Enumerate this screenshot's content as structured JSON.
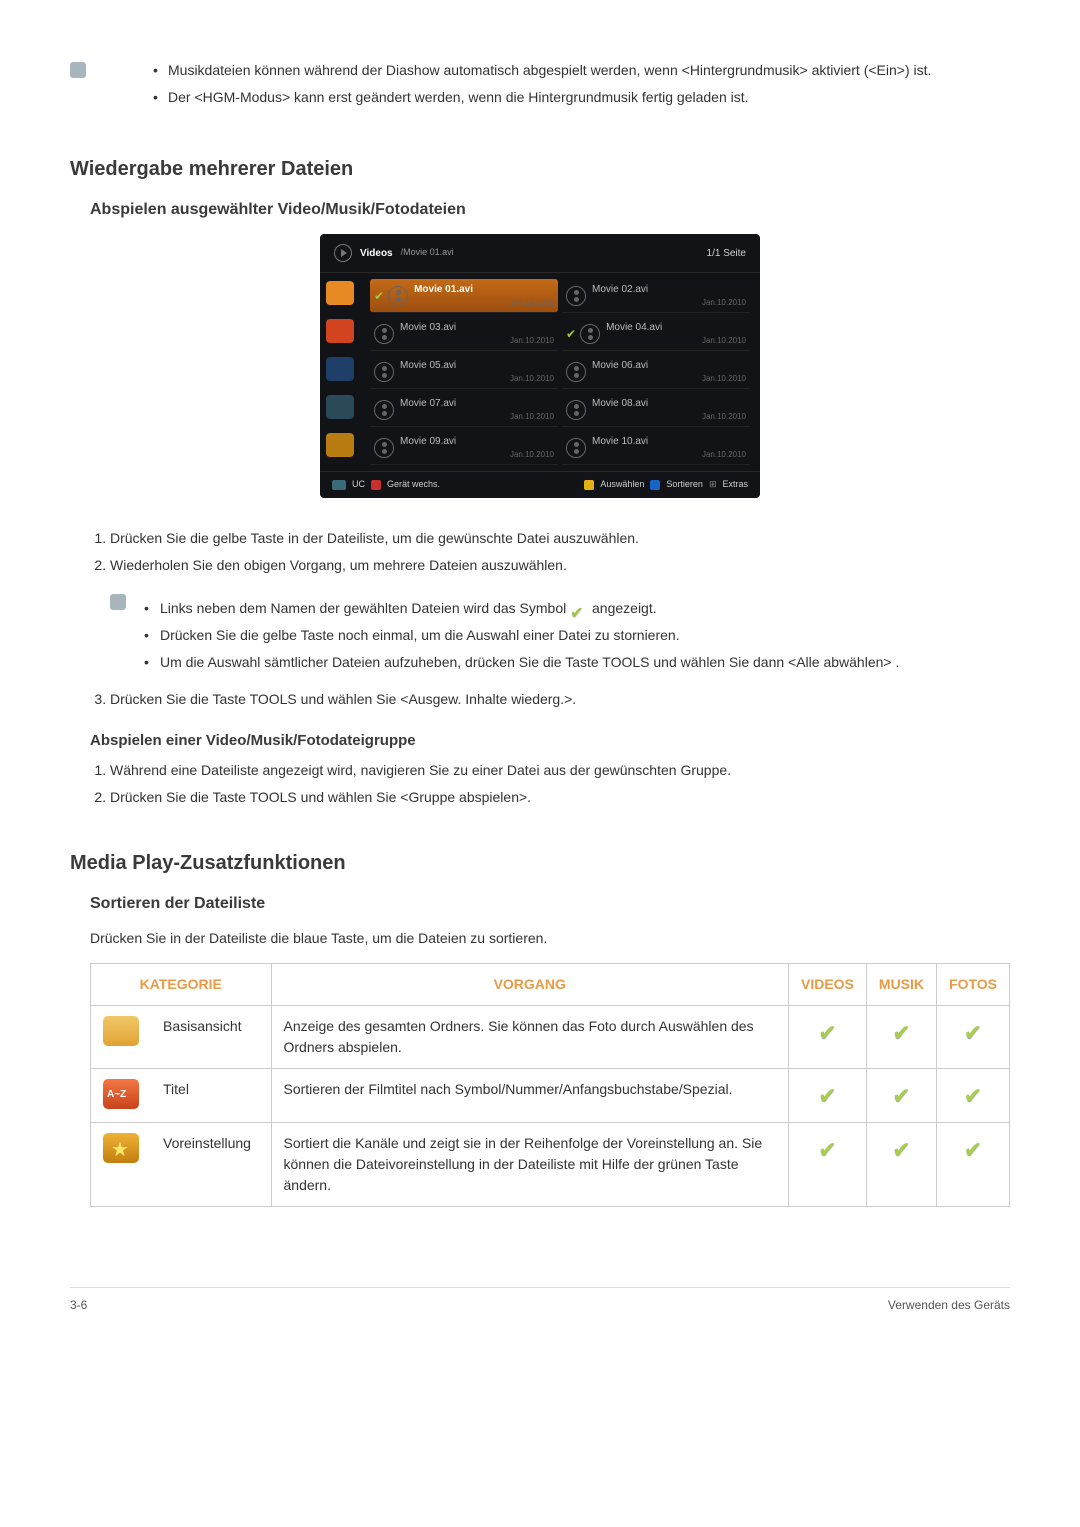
{
  "top_notes": [
    "Musikdateien können während der Diashow automatisch abgespielt werden, wenn <Hintergrundmusik> aktiviert (<Ein>) ist.",
    "Der <HGM-Modus> kann erst geändert werden, wenn die Hintergrundmusik fertig geladen ist."
  ],
  "section1": {
    "title": "Wiedergabe mehrerer Dateien",
    "subtitle": "Abspielen ausgewählter Video/Musik/Fotodateien"
  },
  "screenshot": {
    "category": "Videos",
    "breadcrumb": "/Movie 01.avi",
    "page": "1/1 Seite",
    "files": [
      {
        "name": "Movie 01.avi",
        "date": "Jan.10.2010",
        "checked": true,
        "active": true
      },
      {
        "name": "Movie 02.avi",
        "date": "Jan.10.2010",
        "checked": false,
        "active": false
      },
      {
        "name": "Movie 03.avi",
        "date": "Jan.10.2010",
        "checked": false,
        "active": false
      },
      {
        "name": "Movie 04.avi",
        "date": "Jan.10.2010",
        "checked": true,
        "active": false
      },
      {
        "name": "Movie 05.avi",
        "date": "Jan.10.2010",
        "checked": false,
        "active": false
      },
      {
        "name": "Movie 06.avi",
        "date": "Jan.10.2010",
        "checked": false,
        "active": false
      },
      {
        "name": "Movie 07.avi",
        "date": "Jan.10.2010",
        "checked": false,
        "active": false
      },
      {
        "name": "Movie 08.avi",
        "date": "Jan.10.2010",
        "checked": false,
        "active": false
      },
      {
        "name": "Movie 09.avi",
        "date": "Jan.10.2010",
        "checked": false,
        "active": false
      },
      {
        "name": "Movie 10.avi",
        "date": "Jan.10.2010",
        "checked": false,
        "active": false
      }
    ],
    "footer": {
      "device_btn": "UC",
      "device_label": "Gerät wechs.",
      "select": "Auswählen",
      "sort": "Sortieren",
      "extras": "Extras"
    }
  },
  "steps1": [
    "Drücken Sie die gelbe Taste in der Dateiliste, um die gewünschte Datei auszuwählen.",
    "Wiederholen Sie den obigen Vorgang, um mehrere Dateien auszuwählen."
  ],
  "inner_notes": {
    "line1_before": "Links neben dem Namen der gewählten Dateien wird das Symbol",
    "line1_after": "angezeigt.",
    "line2": "Drücken Sie die gelbe Taste noch einmal, um die Auswahl einer Datei zu stornieren.",
    "line3": "Um die Auswahl sämtlicher Dateien aufzuheben, drücken Sie die Taste TOOLS und wählen Sie dann <Alle abwählen> ."
  },
  "step3": "Drücken Sie die Taste TOOLS und wählen Sie <Ausgew. Inhalte wiederg.>.",
  "group": {
    "title": "Abspielen einer Video/Musik/Fotodateigruppe",
    "steps": [
      "Während eine Dateiliste angezeigt wird, navigieren Sie zu einer Datei aus der gewünschten Gruppe.",
      "Drücken Sie die Taste TOOLS und wählen Sie <Gruppe abspielen>."
    ]
  },
  "section2": {
    "title": "Media Play-Zusatzfunktionen",
    "subtitle": "Sortieren der Dateiliste",
    "desc": "Drücken Sie in der Dateiliste die blaue Taste, um die Dateien zu sortieren."
  },
  "table": {
    "headers": {
      "cat": "KATEGORIE",
      "op": "VORGANG",
      "v": "VIDEOS",
      "m": "MUSIK",
      "p": "FOTOS"
    },
    "rows": [
      {
        "icon": "folder",
        "name": "Basisansicht",
        "op": "Anzeige des gesamten Ordners. Sie können das Foto durch Auswählen des Ordners abspielen."
      },
      {
        "icon": "az",
        "name": "Titel",
        "op": "Sortieren der Filmtitel nach Symbol/Nummer/Anfangsbuchstabe/Spezial."
      },
      {
        "icon": "star",
        "name": "Voreinstellung",
        "op": "Sortiert die Kanäle und zeigt sie in der Reihenfolge der Voreinstellung an. Sie können die Dateivoreinstellung in der Dateiliste mit Hilfe der grünen Taste ändern."
      }
    ]
  },
  "footer": {
    "page": "3-6",
    "right": "Verwenden des Geräts"
  }
}
